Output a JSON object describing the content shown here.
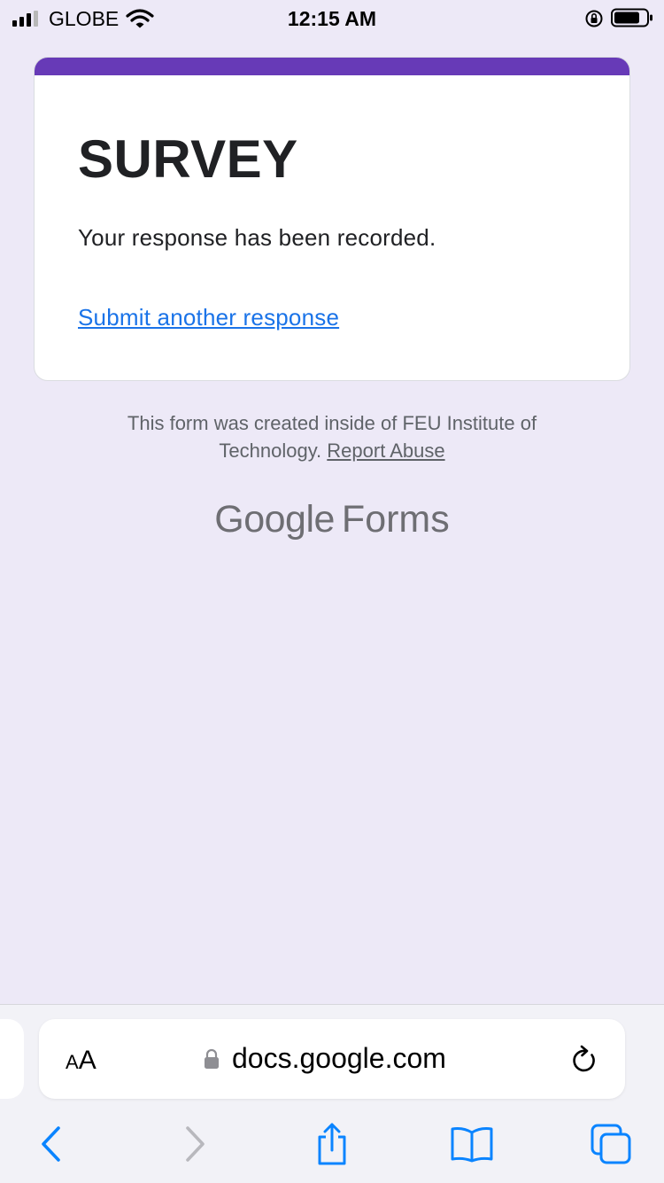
{
  "status_bar": {
    "carrier": "GLOBE",
    "time": "12:15 AM"
  },
  "form": {
    "accent_color": "#673ab7",
    "title": "SURVEY",
    "confirmation": "Your response has been recorded.",
    "submit_another_label": "Submit another response"
  },
  "footer": {
    "note": "This form was created inside of FEU Institute of Technology.",
    "report_abuse_label": "Report Abuse",
    "brand_google": "Google",
    "brand_forms": "Forms"
  },
  "browser": {
    "text_size_small": "A",
    "text_size_large": "A",
    "domain": "docs.google.com",
    "icons": [
      "lock-icon",
      "reload-icon",
      "back-icon",
      "forward-icon",
      "share-icon",
      "bookmarks-icon",
      "tabs-icon"
    ],
    "tint_color": "#0a84ff"
  }
}
